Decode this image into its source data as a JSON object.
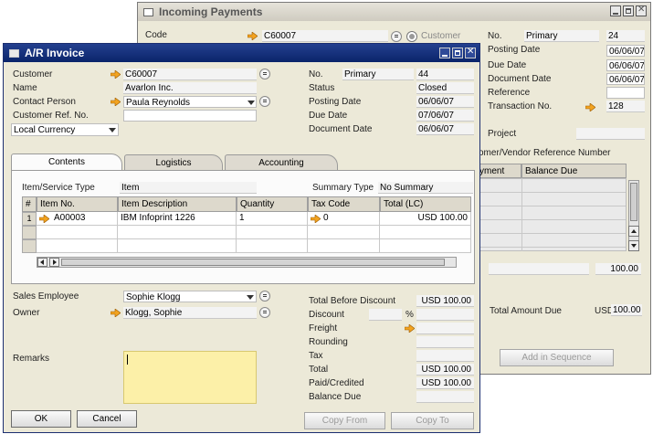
{
  "incoming": {
    "title": "Incoming Payments",
    "code_label": "Code",
    "code_value": "C60007",
    "radio_customer": "Customer",
    "no_label": "No.",
    "no_series": "Primary",
    "no_value": "24",
    "posting_date_label": "Posting Date",
    "posting_date": "06/06/07",
    "due_date_label": "Due Date",
    "due_date": "06/06/07",
    "document_date_label": "Document Date",
    "document_date": "06/06/07",
    "reference_label": "Reference",
    "transaction_no_label": "Transaction No.",
    "transaction_no": "128",
    "project_label": "Project",
    "vendor_ref_label": "comer/Vendor Reference Number",
    "col_payment": "yment",
    "col_balance_due": "Balance Due",
    "side_total": "100.00",
    "total_amount_due_label": "Total Amount Due",
    "total_amount_due_currency": "USD",
    "total_amount_due": "100.00",
    "add_in_sequence": "Add in Sequence"
  },
  "invoice": {
    "title": "A/R Invoice",
    "customer_label": "Customer",
    "customer_code": "C60007",
    "name_label": "Name",
    "name_value": "Avarlon Inc.",
    "contact_label": "Contact Person",
    "contact_value": "Paula Reynolds",
    "custref_label": "Customer Ref. No.",
    "currency_value": "Local Currency",
    "no_label": "No.",
    "no_series": "Primary",
    "no_value": "44",
    "status_label": "Status",
    "status_value": "Closed",
    "posting_date_label": "Posting Date",
    "posting_date": "06/06/07",
    "due_date_label": "Due Date",
    "due_date": "07/06/07",
    "document_date_label": "Document Date",
    "document_date": "06/06/07",
    "tabs": [
      "Contents",
      "Logistics",
      "Accounting"
    ],
    "item_service_type_label": "Item/Service Type",
    "item_service_type": "Item",
    "summary_type_label": "Summary Type",
    "summary_type": "No Summary",
    "columns": [
      "#",
      "Item No.",
      "Item Description",
      "Quantity",
      "Tax Code",
      "Total (LC)"
    ],
    "row1": {
      "num": "1",
      "item_no": "A00003",
      "description": "IBM Infoprint 1226",
      "quantity": "1",
      "tax_code": "0",
      "total": "USD 100.00"
    },
    "sales_employee_label": "Sales Employee",
    "sales_employee": "Sophie Klogg",
    "owner_label": "Owner",
    "owner": "Klogg, Sophie",
    "remarks_label": "Remarks",
    "total_before_discount_label": "Total Before Discount",
    "total_before_discount": "USD 100.00",
    "discount_label": "Discount",
    "discount_pct": "%",
    "freight_label": "Freight",
    "rounding_label": "Rounding",
    "tax_label": "Tax",
    "total_label": "Total",
    "total_value": "USD 100.00",
    "paid_label": "Paid/Credited",
    "paid_value": "USD 100.00",
    "balance_due_label": "Balance Due",
    "ok": "OK",
    "cancel": "Cancel",
    "copy_from": "Copy From",
    "copy_to": "Copy To"
  },
  "colors": {
    "title_active": "#0a246a",
    "title_inactive": "#d4d0c8",
    "remarks_bg": "#fcf0a8",
    "arrow": "#f2a320"
  }
}
